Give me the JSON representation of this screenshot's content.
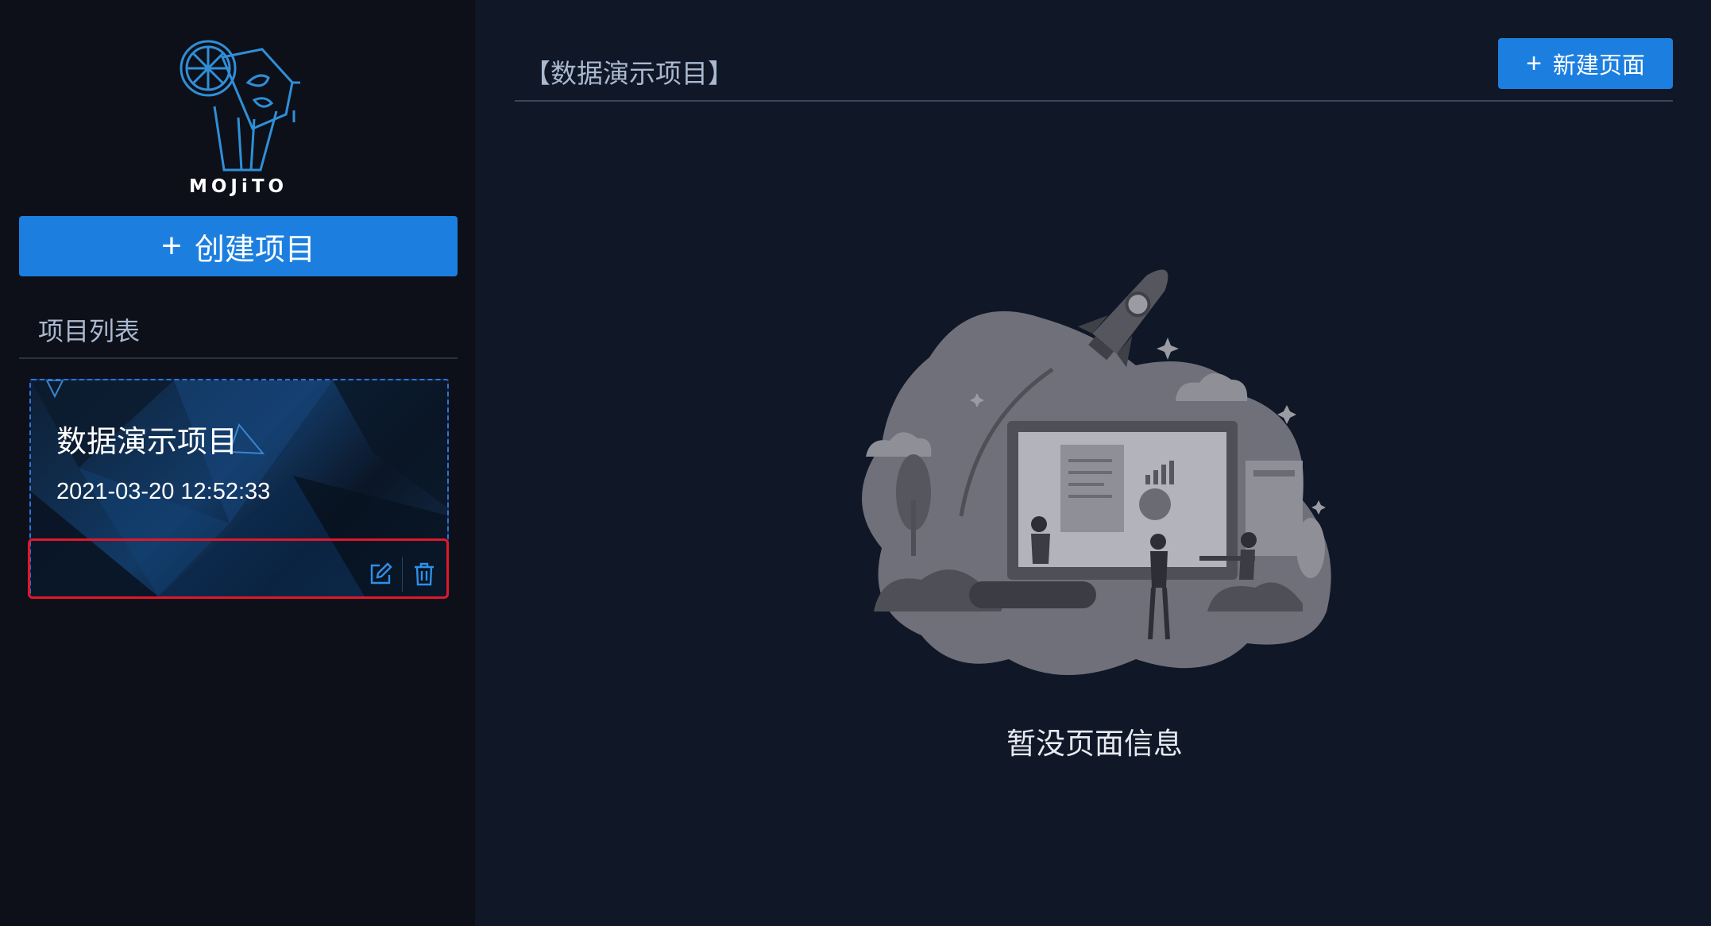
{
  "sidebar": {
    "logo_text": "MOJiTO",
    "create_button_label": "创建项目",
    "list_title": "项目列表",
    "projects": [
      {
        "name": "数据演示项目",
        "time": "2021-03-20 12:52:33",
        "actions": [
          "edit-icon",
          "trash-icon"
        ]
      }
    ]
  },
  "main": {
    "title": "【数据演示项目】",
    "new_page_button_label": "新建页面",
    "empty_text": "暂没页面信息"
  },
  "colors": {
    "primary": "#1c7fe0",
    "sidebar_bg": "#0d1019",
    "main_bg": "#101726",
    "highlight": "#e0182a",
    "card_border": "#2d73e0"
  }
}
